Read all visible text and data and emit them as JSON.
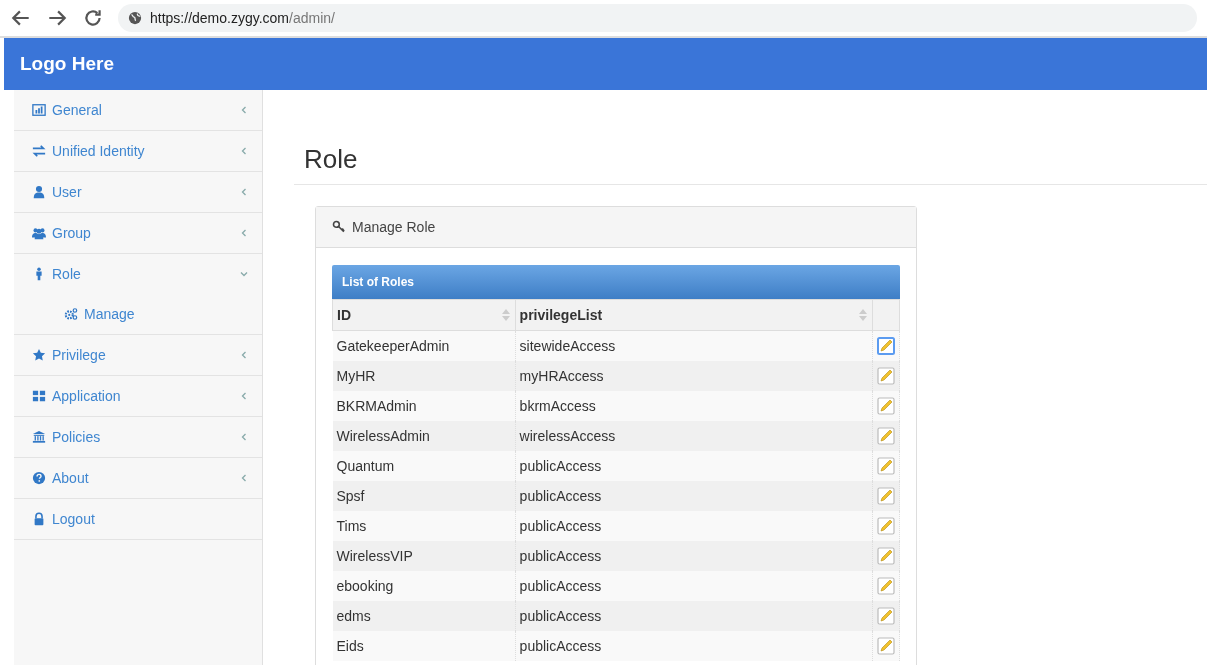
{
  "browser": {
    "url_host": "https://demo.zygy.com",
    "url_path": "/admin/"
  },
  "header": {
    "logo": "Logo Here"
  },
  "sidebar": {
    "items": [
      {
        "label": "General",
        "kind": "submenu",
        "expanded": false
      },
      {
        "label": "Unified Identity",
        "kind": "submenu",
        "expanded": false
      },
      {
        "label": "User",
        "kind": "submenu",
        "expanded": false
      },
      {
        "label": "Group",
        "kind": "submenu",
        "expanded": false
      },
      {
        "label": "Role",
        "kind": "submenu",
        "expanded": true,
        "children": [
          {
            "label": "Manage"
          }
        ]
      },
      {
        "label": "Privilege",
        "kind": "submenu",
        "expanded": false
      },
      {
        "label": "Application",
        "kind": "submenu",
        "expanded": false
      },
      {
        "label": "Policies",
        "kind": "submenu",
        "expanded": false
      },
      {
        "label": "About",
        "kind": "submenu",
        "expanded": false
      },
      {
        "label": "Logout",
        "kind": "link",
        "expanded": false
      }
    ]
  },
  "page": {
    "title": "Role"
  },
  "panel": {
    "title": "Manage Role",
    "table": {
      "caption": "List of Roles",
      "columns": [
        "ID",
        "privilegeList"
      ],
      "rows": [
        {
          "id": "GatekeeperAdmin",
          "privileges": "sitewideAccess",
          "focused": true
        },
        {
          "id": "MyHR",
          "privileges": "myHRAccess",
          "focused": false
        },
        {
          "id": "BKRMAdmin",
          "privileges": "bkrmAccess",
          "focused": false
        },
        {
          "id": "WirelessAdmin",
          "privileges": "wirelessAccess",
          "focused": false
        },
        {
          "id": "Quantum",
          "privileges": "publicAccess",
          "focused": false
        },
        {
          "id": "Spsf",
          "privileges": "publicAccess",
          "focused": false
        },
        {
          "id": "Tims",
          "privileges": "publicAccess",
          "focused": false
        },
        {
          "id": "WirelessVIP",
          "privileges": "publicAccess",
          "focused": false
        },
        {
          "id": "ebooking",
          "privileges": "publicAccess",
          "focused": false
        },
        {
          "id": "edms",
          "privileges": "publicAccess",
          "focused": false
        },
        {
          "id": "Eids",
          "privileges": "publicAccess",
          "focused": false
        }
      ]
    }
  }
}
